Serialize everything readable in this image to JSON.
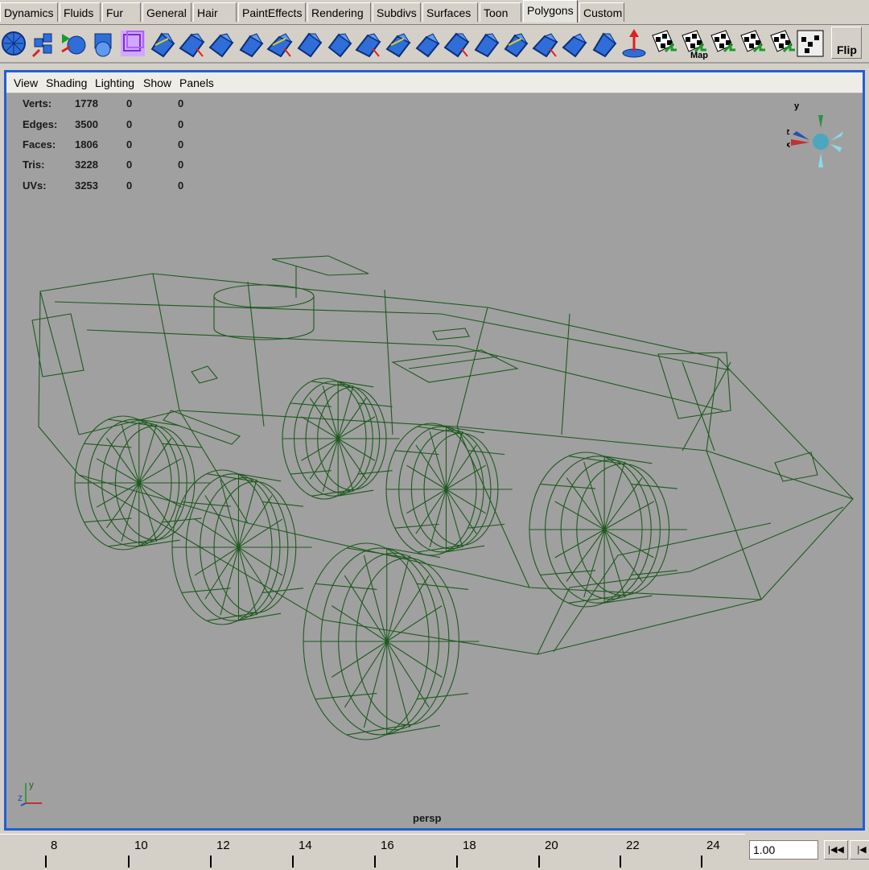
{
  "shelf_tabs": [
    "Dynamics",
    "Fluids",
    "Fur",
    "General",
    "Hair",
    "PaintEffects",
    "Rendering",
    "Subdivs",
    "Surfaces",
    "Toon",
    "Polygons",
    "Custom"
  ],
  "active_tab": "Polygons",
  "shelf_buttons": {
    "flip_label": "Flip",
    "map_label": "Map",
    "icons": [
      "sphere-icon",
      "cubes-icon",
      "sphere-arrow-icon",
      "cube-sphere-icon",
      "wire-cube-icon",
      "plane-icon",
      "plane-arrow-icon",
      "extrude-icon",
      "bevel-icon",
      "wedge-icon",
      "split-icon",
      "merge-icon",
      "bridge-icon",
      "append-icon",
      "smooth-icon",
      "subdivide-icon",
      "split-edge-icon",
      "cut-face-icon",
      "collapse-icon",
      "facet-icon",
      "soften-icon",
      "cone-icon",
      "checker-icon",
      "checker-map-icon",
      "cylinder-map-icon",
      "sphere-map-icon",
      "auto-map-icon",
      "uv-editor-icon"
    ]
  },
  "viewport": {
    "menu": [
      "View",
      "Shading",
      "Lighting",
      "Show",
      "Panels"
    ],
    "hud": [
      {
        "label": "Verts:",
        "total": "1778",
        "selected": "0",
        "sub": "0"
      },
      {
        "label": "Edges:",
        "total": "3500",
        "selected": "0",
        "sub": "0"
      },
      {
        "label": "Faces:",
        "total": "1806",
        "selected": "0",
        "sub": "0"
      },
      {
        "label": "Tris:",
        "total": "3228",
        "selected": "0",
        "sub": "0"
      },
      {
        "label": "UVs:",
        "total": "3253",
        "selected": "0",
        "sub": "0"
      }
    ],
    "camera_name": "persp",
    "view_cube_axes": {
      "y": "y",
      "z": "z",
      "x": "x"
    },
    "origin_axes": {
      "y": "y",
      "z": "z"
    },
    "wire_color": "#1e5a1e",
    "background_color": "#a0a0a0",
    "object": "8-wheeled armored vehicle wireframe"
  },
  "timeline": {
    "ticks": [
      "8",
      "10",
      "12",
      "14",
      "16",
      "18",
      "20",
      "22",
      "24"
    ],
    "current_frame": "1.00",
    "buttons": [
      "go-to-start-icon",
      "step-back-icon"
    ]
  }
}
